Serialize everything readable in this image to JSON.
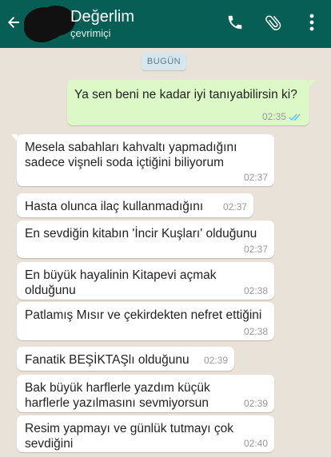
{
  "header": {
    "contact_name": "Değerlim",
    "status": "çevrimiçi",
    "back_icon": "arrow-left-icon",
    "call_icon": "phone-icon",
    "attach_icon": "paperclip-icon",
    "menu_icon": "more-vert-icon"
  },
  "colors": {
    "header_bg": "#075e54",
    "outgoing_bubble": "#dcf8c6",
    "incoming_bubble": "#ffffff",
    "read_ticks": "#4fc3f7",
    "date_chip": "#d5e6ef"
  },
  "chat": {
    "date_label": "BUGÜN",
    "messages": [
      {
        "direction": "out",
        "text": "Ya sen beni ne kadar iyi tanıyabilirsin ki?",
        "time": "02:35",
        "status": "read"
      },
      {
        "direction": "in",
        "text": "Mesela sabahları kahvaltı yapmadığını sadece vişneli soda içtiğini biliyorum",
        "time": "02:37"
      },
      {
        "direction": "in",
        "text": "Hasta olunca ilaç kullanmadığını",
        "time": "02:37"
      },
      {
        "direction": "in",
        "text": "En sevdiğin kitabın 'İncir Kuşları' olduğunu",
        "time": "02:37"
      },
      {
        "direction": "in",
        "text": "En büyük hayalinin Kitapevi açmak olduğunu",
        "time": "02:38"
      },
      {
        "direction": "in",
        "text": "Patlamış Mısır ve çekirdekten nefret ettiğini",
        "time": "02:38"
      },
      {
        "direction": "in",
        "text": "Fanatik BEŞİKTAŞlı olduğunu",
        "time": "02:39"
      },
      {
        "direction": "in",
        "text": "Bak büyük harflerle yazdım küçük harflerle yazılmasını sevmiyorsun",
        "time": "02:39"
      },
      {
        "direction": "in",
        "text": "Resim yapmayı ve günlük tutmayı çok sevdiğini",
        "time": "02:40"
      }
    ]
  }
}
